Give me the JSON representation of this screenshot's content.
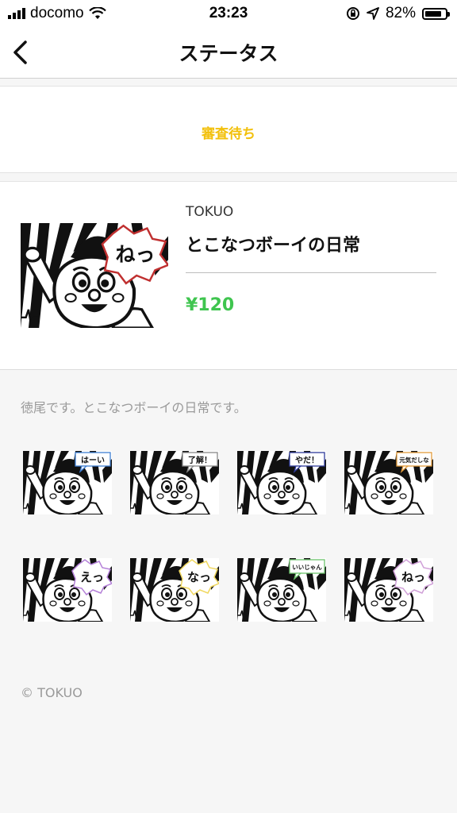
{
  "statusbar": {
    "carrier": "docomo",
    "time": "23:23",
    "battery": "82%",
    "battery_level": 0.82
  },
  "nav": {
    "title": "ステータス",
    "back_icon": "chevron-left-icon"
  },
  "status": {
    "label": "審査待ち",
    "color": "#f2c00b"
  },
  "product": {
    "creator": "TOKUO",
    "title": "とこなつボーイの日常",
    "price": "¥120",
    "price_color": "#3fc54f",
    "main_bubble": "ねっ"
  },
  "description": "徳尾です。とこなつボーイの日常です。",
  "stickers": [
    {
      "bubble": "はーい",
      "accent": "#3f7fd3"
    },
    {
      "bubble": "了解！",
      "accent": "#888888"
    },
    {
      "bubble": "やだ！",
      "accent": "#2f3b9a"
    },
    {
      "bubble": "元気だしな",
      "accent": "#e29b3b"
    },
    {
      "bubble": "えっ",
      "accent": "#b480d8"
    },
    {
      "bubble": "なっ",
      "accent": "#f0d860"
    },
    {
      "bubble": "いいじゃん",
      "accent": "#6cc46c"
    },
    {
      "bubble": "ねっ",
      "accent": "#d0a0d8"
    }
  ],
  "footer": {
    "copyright": "© TOKUO"
  }
}
